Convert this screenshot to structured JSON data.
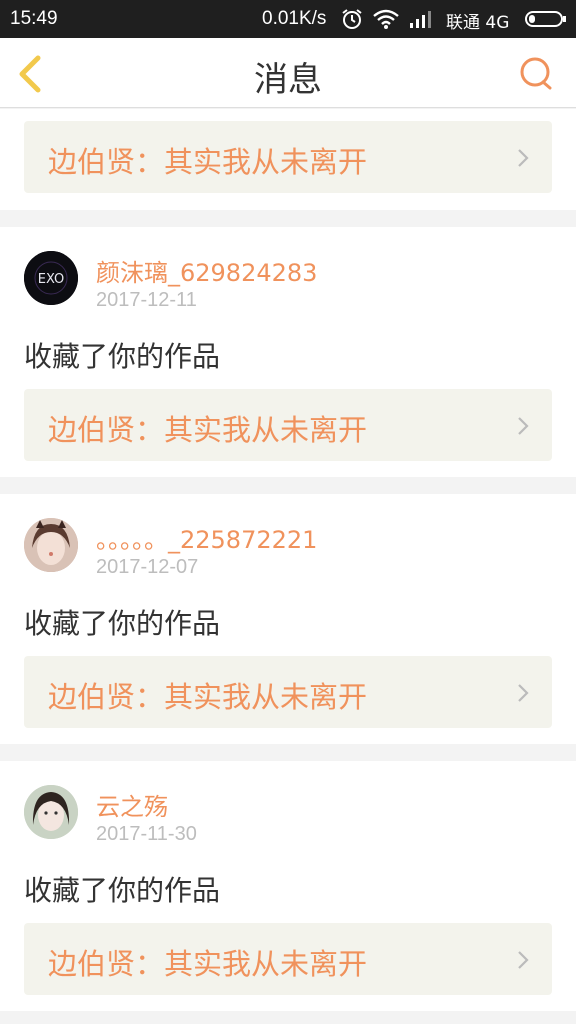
{
  "status_bar": {
    "time": "15:49",
    "network_speed": "0.01K/s",
    "carrier": "联通 4G",
    "icons": [
      "alarm-icon",
      "wifi-icon",
      "signal-icon",
      "battery-icon"
    ]
  },
  "header": {
    "title": "消息",
    "back_icon": "chevron-left-icon",
    "search_icon": "search-icon"
  },
  "colors": {
    "accent": "#f0925c",
    "back_icon": "#f2c94c",
    "status_bar_bg": "#1f1f1f",
    "work_bg": "#f3f3ec",
    "date_text": "#bdbdbd"
  },
  "top_work": {
    "title": "边伯贤：其实我从未离开"
  },
  "messages": [
    {
      "username": "颜沫璃_629824283",
      "date": "2017-12-11",
      "action": "收藏了你的作品",
      "work_title": "边伯贤：其实我从未离开",
      "avatar_text": "EXO"
    },
    {
      "username": "。。。。。_225872221",
      "date": "2017-12-07",
      "action": "收藏了你的作品",
      "work_title": "边伯贤：其实我从未离开"
    },
    {
      "username": "云之殇",
      "date": "2017-11-30",
      "action": "收藏了你的作品",
      "work_title": "边伯贤：其实我从未离开"
    }
  ]
}
